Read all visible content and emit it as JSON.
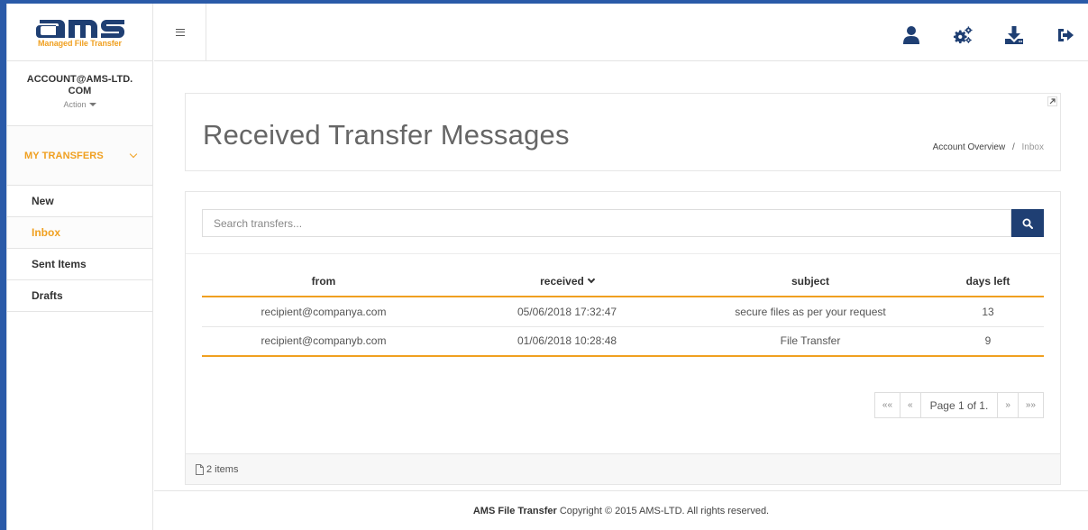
{
  "brand": {
    "logo_text": "ams",
    "tagline": "Managed File Transfer",
    "colors": {
      "primary": "#1f3f73",
      "accent": "#f0a020",
      "frame": "#2a5aa8"
    }
  },
  "account": {
    "name": "ACCOUNT@AMS-LTD.COM",
    "action_label": "Action"
  },
  "sidebar": {
    "section_label": "MY TRANSFERS",
    "items": [
      {
        "label": "New",
        "active": false
      },
      {
        "label": "Inbox",
        "active": true
      },
      {
        "label": "Sent Items",
        "active": false
      },
      {
        "label": "Drafts",
        "active": false
      }
    ]
  },
  "topbar": {
    "icons": [
      "menu-icon",
      "user-icon",
      "settings-icon",
      "download-icon",
      "logout-icon"
    ]
  },
  "page": {
    "title": "Received Transfer Messages",
    "breadcrumb": {
      "parent": "Account Overview",
      "separator": "/",
      "current": "Inbox"
    }
  },
  "search": {
    "placeholder": "Search transfers...",
    "value": ""
  },
  "table": {
    "columns": [
      "from",
      "received",
      "subject",
      "days left"
    ],
    "sort_column": "received",
    "rows": [
      {
        "from": "recipient@companya.com",
        "received": "05/06/2018 17:32:47",
        "subject": "secure files as per your request",
        "days_left": "13"
      },
      {
        "from": "recipient@companyb.com",
        "received": "01/06/2018 10:28:48",
        "subject": "File Transfer",
        "days_left": "9"
      }
    ]
  },
  "pagination": {
    "first": "««",
    "prev": "«",
    "label": "Page 1 of 1.",
    "next": "»",
    "last": "»»"
  },
  "panel_footer": {
    "count_label": "2 items"
  },
  "footer": {
    "brand": "AMS File Transfer",
    "text": "Copyright © 2015 AMS-LTD. All rights reserved."
  }
}
